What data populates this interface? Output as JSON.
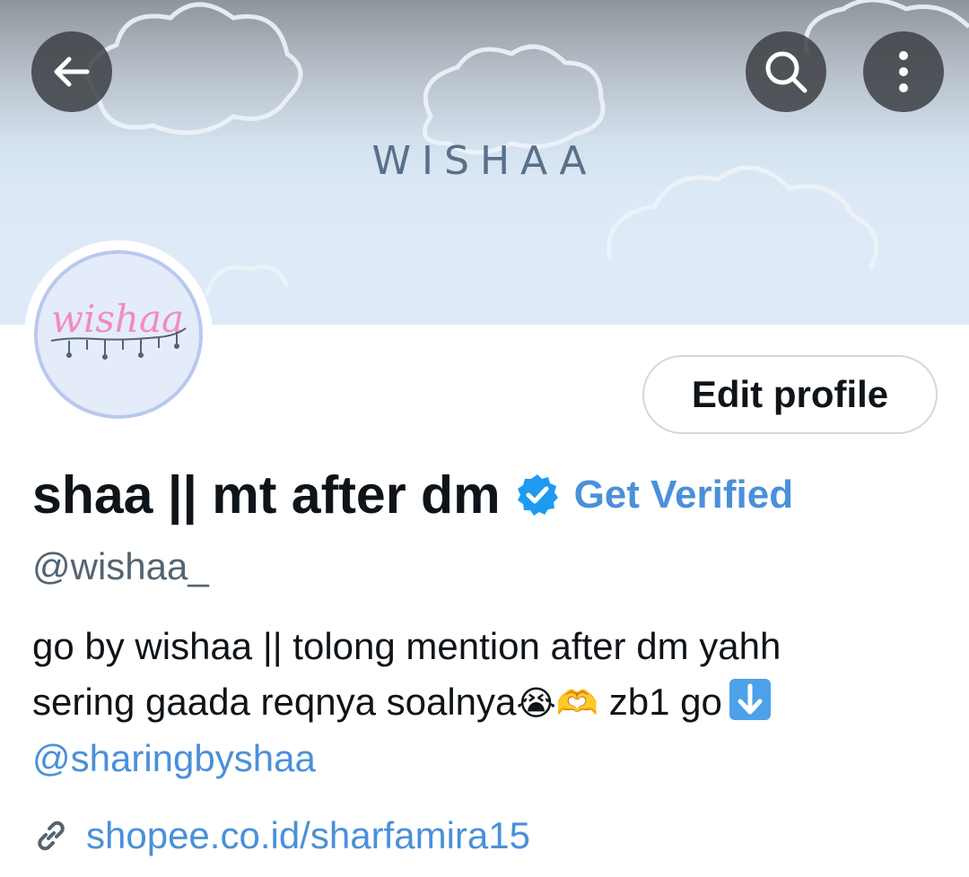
{
  "header": {
    "banner_title": "WISHAA",
    "back_icon": "arrow-left-icon",
    "search_icon": "search-icon",
    "more_icon": "more-vertical-icon"
  },
  "profile": {
    "avatar_text": "wishaa",
    "edit_button_label": "Edit profile",
    "display_name": "shaa || mt after dm",
    "verified_icon": "verified-badge-icon",
    "get_verified_label": "Get Verified",
    "handle": "@wishaa_",
    "bio_line1": "go by wishaa || tolong mention after dm yahh",
    "bio_line2_text": "sering gaada reqnya soalnya",
    "bio_emoji_1": "😭",
    "bio_emoji_2": "🫶",
    "bio_line2_tail": " zb1 go",
    "bio_down_icon": "down-arrow-emoji-icon",
    "bio_mention": "@sharingbyshaa",
    "link_icon": "link-icon",
    "website": "shopee.co.id/sharfamira15"
  },
  "colors": {
    "accent": "#4a90d9",
    "text_primary": "#0f1419",
    "text_secondary": "#536471",
    "verified_blue": "#1d9bf0"
  }
}
